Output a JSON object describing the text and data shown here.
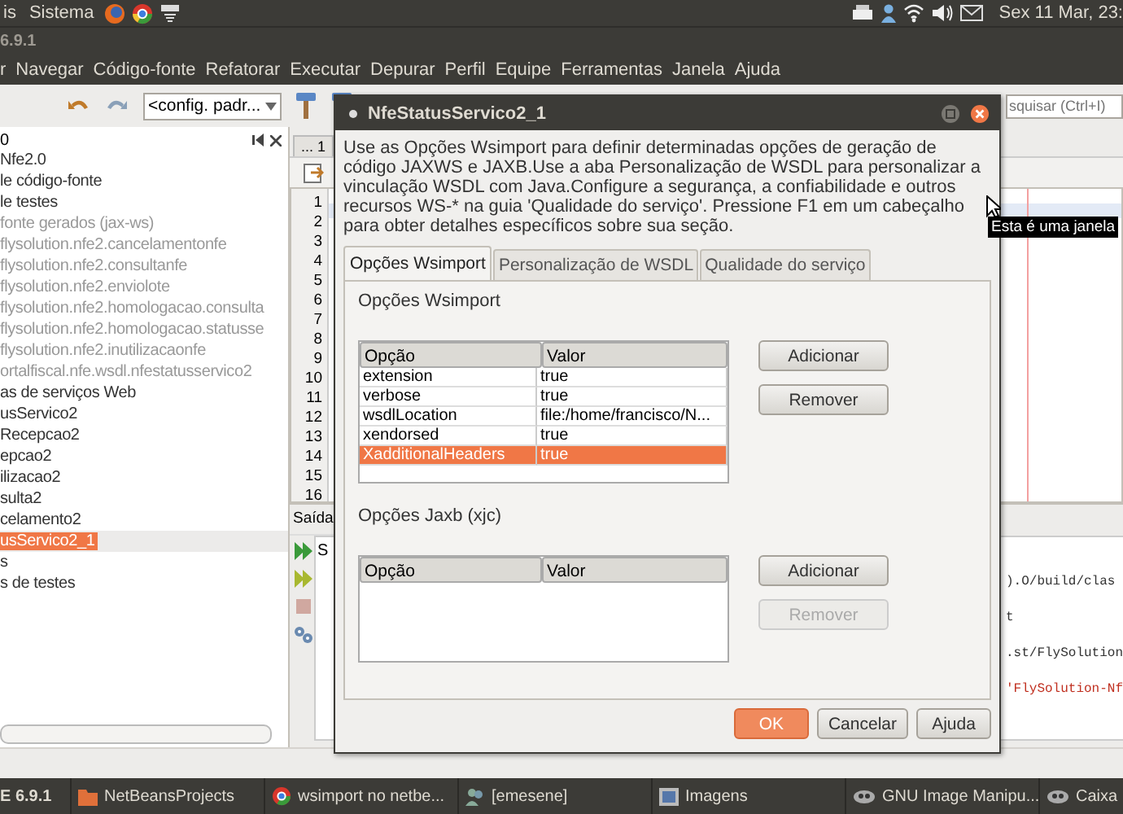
{
  "top_panel": {
    "menu_1": "is",
    "menu_2": "Sistema",
    "clock": "Sex 11 Mar, 23:"
  },
  "ide": {
    "title": "6.9.1",
    "menu": [
      "r",
      "Navegar",
      "Código-fonte",
      "Refatorar",
      "Executar",
      "Depurar",
      "Perfil",
      "Equipe",
      "Ferramentas",
      "Janela",
      "Ajuda"
    ],
    "config_combo": "<config. padr...",
    "search": {
      "placeholder": "squisar (Ctrl+I)"
    }
  },
  "projects": {
    "header": "0",
    "items": [
      {
        "label": "Nfe2.0",
        "dimmed": false,
        "selected": false
      },
      {
        "label": "le código-fonte",
        "dimmed": false,
        "selected": false
      },
      {
        "label": "le testes",
        "dimmed": false,
        "selected": false
      },
      {
        "label": "fonte gerados (jax-ws)",
        "dimmed": true,
        "selected": false
      },
      {
        "label": "flysolution.nfe2.cancelamentonfe",
        "dimmed": true,
        "selected": false
      },
      {
        "label": "flysolution.nfe2.consultanfe",
        "dimmed": true,
        "selected": false
      },
      {
        "label": "flysolution.nfe2.enviolote",
        "dimmed": true,
        "selected": false
      },
      {
        "label": "flysolution.nfe2.homologacao.consulta",
        "dimmed": true,
        "selected": false
      },
      {
        "label": "flysolution.nfe2.homologacao.statusse",
        "dimmed": true,
        "selected": false
      },
      {
        "label": "flysolution.nfe2.inutilizacaonfe",
        "dimmed": true,
        "selected": false
      },
      {
        "label": "ortalfiscal.nfe.wsdl.nfestatusservico2",
        "dimmed": true,
        "selected": false
      },
      {
        "label": "as de serviços Web",
        "dimmed": false,
        "selected": false
      },
      {
        "label": "usServico2",
        "dimmed": false,
        "selected": false
      },
      {
        "label": "Recepcao2",
        "dimmed": false,
        "selected": false
      },
      {
        "label": "epcao2",
        "dimmed": false,
        "selected": false
      },
      {
        "label": "ilizacao2",
        "dimmed": false,
        "selected": false
      },
      {
        "label": "sulta2",
        "dimmed": false,
        "selected": false
      },
      {
        "label": "celamento2",
        "dimmed": false,
        "selected": false
      },
      {
        "label": "usServico2_1",
        "dimmed": false,
        "selected": true
      },
      {
        "label": "s",
        "dimmed": false,
        "selected": false
      },
      {
        "label": "s de testes",
        "dimmed": false,
        "selected": false
      }
    ]
  },
  "editor": {
    "tab": "... 1",
    "line_numbers": [
      "1",
      "2",
      "3",
      "4",
      "5",
      "6",
      "7",
      "8",
      "9",
      "10",
      "11",
      "12",
      "13",
      "14",
      "15",
      "16"
    ]
  },
  "output": {
    "title": "Saída",
    "tab": "S",
    "lines": [
      {
        "text": ").O/build/clas",
        "kind": "normal"
      },
      {
        "text": "t",
        "kind": "normal"
      },
      {
        "text": ".st/FlySolution",
        "kind": "normal"
      },
      {
        "text": "'FlySolution-Nf",
        "kind": "error"
      }
    ]
  },
  "tooltip": "Esta é uma janela",
  "dialog": {
    "title": "NfeStatusServico2_1",
    "description": "Use as Opções Wsimport para definir determinadas opções de geração de código JAXWS e JAXB.Use a aba Personalização de WSDL para personalizar a vinculação WSDL com Java.Configure a segurança, a confiabilidade e outros recursos WS-* na guia 'Qualidade do serviço'. Pressione F1 em um cabeçalho para obter detalhes específicos sobre sua seção.",
    "tabs": [
      {
        "label": "Opções Wsimport",
        "selected": true
      },
      {
        "label": "Personalização de WSDL",
        "selected": false
      },
      {
        "label": "Qualidade do serviço",
        "selected": false
      }
    ],
    "wsimport": {
      "heading": "Opções Wsimport",
      "columns": [
        "Opção",
        "Valor"
      ],
      "rows": [
        {
          "cells": [
            "extension",
            "true"
          ],
          "selected": false
        },
        {
          "cells": [
            "verbose",
            "true"
          ],
          "selected": false
        },
        {
          "cells": [
            "wsdlLocation",
            "file:/home/francisco/N..."
          ],
          "selected": false
        },
        {
          "cells": [
            "xendorsed",
            "true"
          ],
          "selected": false
        },
        {
          "cells": [
            "XadditionalHeaders",
            "true"
          ],
          "selected": true
        }
      ],
      "buttons": [
        {
          "label": "Adicionar",
          "disabled": false
        },
        {
          "label": "Remover",
          "disabled": false
        }
      ]
    },
    "jaxb": {
      "heading": "Opções Jaxb (xjc)",
      "columns": [
        "Opção",
        "Valor"
      ],
      "buttons": [
        {
          "label": "Adicionar",
          "disabled": false
        },
        {
          "label": "Remover",
          "disabled": true
        }
      ]
    },
    "footer_buttons": [
      {
        "label": "OK",
        "kind": "default"
      },
      {
        "label": "Cancelar",
        "kind": "normal"
      },
      {
        "label": "Ajuda",
        "kind": "normal"
      }
    ]
  },
  "taskbar": [
    "E 6.9.1",
    "NetBeansProjects",
    "wsimport no netbe...",
    "[emesene]",
    "Imagens",
    "GNU Image Manipu...",
    "Caixa"
  ]
}
